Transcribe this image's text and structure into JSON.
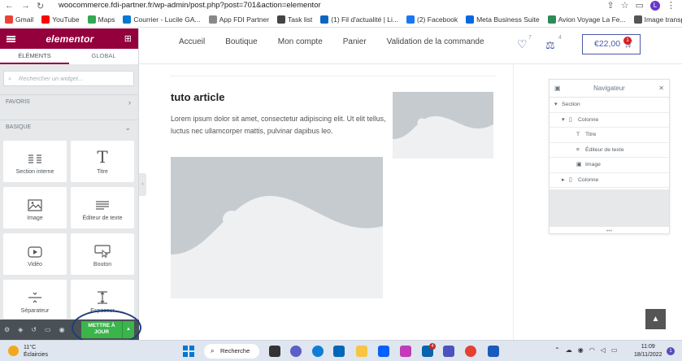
{
  "browser": {
    "url": "woocommerce.fdi-partner.fr/wp-admin/post.php?post=701&action=elementor",
    "profile_initial": "L"
  },
  "bookmarks": [
    {
      "label": "Gmail",
      "color": "#ea4335"
    },
    {
      "label": "YouTube",
      "color": "#ff0000"
    },
    {
      "label": "Maps",
      "color": "#34a853"
    },
    {
      "label": "Courrier - Lucile GA...",
      "color": "#0078d4"
    },
    {
      "label": "App FDI Partner",
      "color": "#888888"
    },
    {
      "label": "Task list",
      "color": "#444444"
    },
    {
      "label": "(1) Fil d'actualité | Li...",
      "color": "#0a66c2"
    },
    {
      "label": "(2) Facebook",
      "color": "#1877f2"
    },
    {
      "label": "Meta Business Suite",
      "color": "#0668e1"
    },
    {
      "label": "Avion Voyage La Fe...",
      "color": "#2e8b57"
    },
    {
      "label": "Image transparente...",
      "color": "#555555"
    }
  ],
  "panel": {
    "logo": "elementor",
    "tabs": [
      "ÉLÉMENTS",
      "GLOBAL"
    ],
    "search_placeholder": "Rechercher un widget...",
    "favorites_label": "FAVORIS",
    "basic_label": "BASIQUE",
    "widgets": [
      {
        "label": "Section interne",
        "icon": "section-icon"
      },
      {
        "label": "Titre",
        "icon": "title-icon"
      },
      {
        "label": "Image",
        "icon": "image-icon"
      },
      {
        "label": "Éditeur de texte",
        "icon": "text-editor-icon"
      },
      {
        "label": "Vidéo",
        "icon": "video-icon"
      },
      {
        "label": "Bouton",
        "icon": "button-icon"
      },
      {
        "label": "Séparateur",
        "icon": "divider-icon"
      },
      {
        "label": "Espaceur",
        "icon": "spacer-icon"
      }
    ],
    "update_label": "METTRE À JOUR",
    "accent": "#93003c"
  },
  "site": {
    "nav": [
      "Accueil",
      "Boutique",
      "Mon compte",
      "Panier",
      "Validation de la commande"
    ],
    "wishlist_count": "7",
    "compare_count": "4",
    "cart_total": "€22,00",
    "cart_count": "1"
  },
  "article": {
    "title": "tuto article",
    "body": "Lorem ipsum dolor sit amet, consectetur adipiscing elit. Ut elit tellus, luctus nec ullamcorper mattis, pulvinar dapibus leo."
  },
  "navigator": {
    "title": "Navigateur",
    "items": [
      {
        "label": "Section",
        "level": 0,
        "arrow": "▾",
        "icon": ""
      },
      {
        "label": "Colonne",
        "level": 1,
        "arrow": "▾",
        "icon": "▯"
      },
      {
        "label": "Titre",
        "level": 2,
        "arrow": "",
        "icon": "T"
      },
      {
        "label": "Éditeur de texte",
        "level": 2,
        "arrow": "",
        "icon": "≡"
      },
      {
        "label": "Image",
        "level": 2,
        "arrow": "",
        "icon": "▣"
      },
      {
        "label": "Colonne",
        "level": 1,
        "arrow": "▸",
        "icon": "▯"
      }
    ]
  },
  "taskbar": {
    "temperature": "11°C",
    "weather": "Éclaircies",
    "search_label": "Recherche",
    "time": "11:09",
    "date": "18/11/2022",
    "notification_count": "1",
    "teams_badge": "4"
  }
}
